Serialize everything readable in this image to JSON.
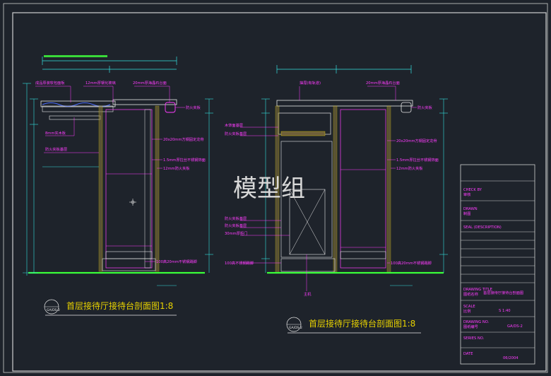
{
  "watermark": "模型组",
  "colors": {
    "background": "#1e232b",
    "frame": "#d8d8d8",
    "annotation": "#ff3cff",
    "dimension": "#35e0e0",
    "floor": "#39ff39",
    "yellow": "#e8d200"
  },
  "left_section": {
    "title": "首层接待厅接待台剖面图1:8",
    "labels": [
      "成品原装软包面板",
      "12mm厚钢化玻璃",
      "20mm厚海晶石台面",
      "防火夹板",
      "8mm实木板",
      "防火夹板基层",
      "20x20mm方钢固定龙骨",
      "1.5mm厚拉丝不锈钢饰面",
      "12mm防火夹板",
      "100高20mm不锈钢踢脚"
    ]
  },
  "right_section": {
    "title": "首层接待厅接待台剖面图1:8",
    "labels": [
      "抽屉(有轨道)",
      "20mm厚海晶石台面",
      "防火夹板",
      "木饰面基层",
      "防火夹板基层",
      "20x20mm方钢固定龙骨",
      "1.5mm厚拉丝不锈钢饰面",
      "12mm防火夹板",
      "防火夹板基层",
      "防火夹板基层",
      "30mm厚柜门",
      "100高不锈钢踢脚",
      "100高20mm不锈钢踢脚",
      "主机"
    ]
  },
  "title_block": {
    "check_by": "CHECK BY",
    "check_by_cn": "审核",
    "drawn": "DRAWN",
    "drawn_cn": "制图",
    "seal": "SEAL (DESCRIPTION)",
    "drawing_title": "DRAWING TITLE",
    "drawing_title_cn": "图纸名称",
    "drawing_title_value": "首层接待厅接待台剖面图",
    "scale": "SCALE",
    "scale_cn": "比例",
    "scale_value": "S  1:40",
    "drawing_no": "DRAWING NO.",
    "drawing_no_cn": "图纸编号",
    "drawing_no_value": "GA/DS-2",
    "series_no": "SERIES NO.",
    "date": "DATE",
    "date_value": "06/2004"
  }
}
